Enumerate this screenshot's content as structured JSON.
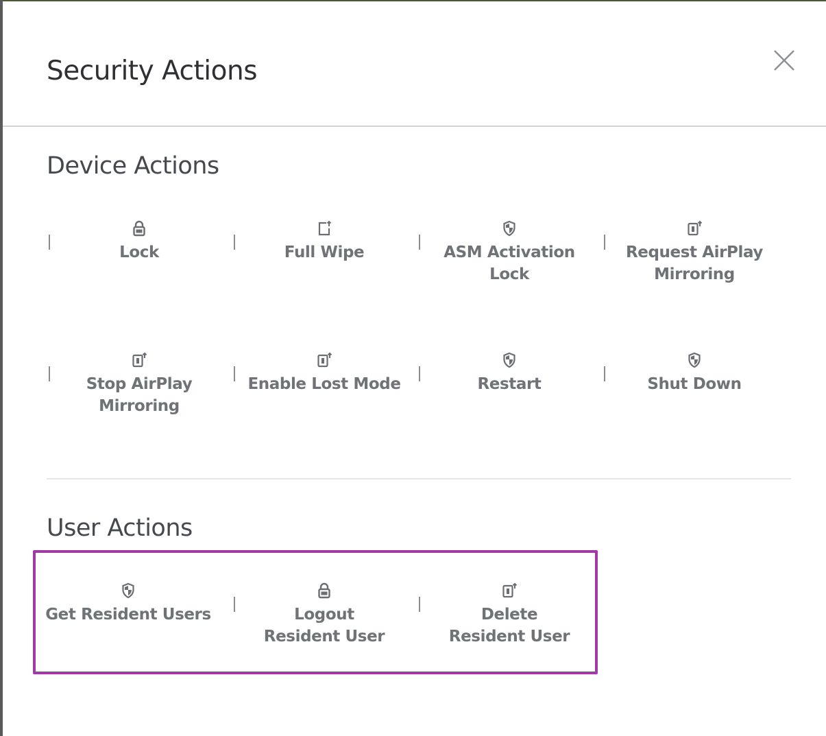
{
  "dialog": {
    "title": "Security Actions"
  },
  "icons": {
    "close": "close-icon",
    "lock": "lock-icon",
    "wipe": "wipe-icon",
    "shield": "shield-icon",
    "airplay": "airplay-icon"
  },
  "colors": {
    "highlight_border": "#a23aa6",
    "label_text": "#6f7378",
    "icon": "#6a6e73"
  },
  "device_actions": {
    "heading": "Device Actions",
    "items": [
      {
        "label": "Lock",
        "icon": "lock-icon"
      },
      {
        "label": "Full Wipe",
        "icon": "wipe-icon"
      },
      {
        "label": "ASM Activation Lock",
        "icon": "shield-icon"
      },
      {
        "label": "Request AirPlay Mirroring",
        "icon": "airplay-icon"
      },
      {
        "label": "Stop AirPlay Mirroring",
        "icon": "airplay-icon"
      },
      {
        "label": "Enable Lost Mode",
        "icon": "airplay-icon"
      },
      {
        "label": "Restart",
        "icon": "shield-icon"
      },
      {
        "label": "Shut Down",
        "icon": "shield-icon"
      }
    ]
  },
  "user_actions": {
    "heading": "User Actions",
    "items": [
      {
        "label": "Get Resident Users",
        "icon": "shield-icon"
      },
      {
        "label": "Logout Resident User",
        "icon": "lock-icon"
      },
      {
        "label": "Delete Resident User",
        "icon": "airplay-icon"
      }
    ]
  }
}
